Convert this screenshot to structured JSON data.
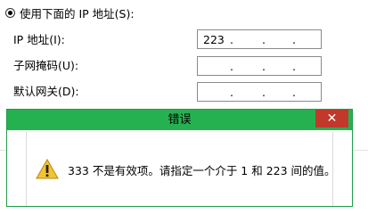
{
  "radio_use_ip": {
    "label": "使用下面的 IP 地址(S):"
  },
  "fields": {
    "ip": {
      "label": "IP 地址(I):",
      "value": "223"
    },
    "mask": {
      "label": "子网掩码(U):",
      "value": ""
    },
    "gateway": {
      "label": "默认网关(D):",
      "value": ""
    }
  },
  "ip_dot": ".",
  "dialog": {
    "title": "错误",
    "close_glyph": "✕",
    "message": "333 不是有效项。请指定一个介于 1 和 223 间的值。",
    "icon": "warning-icon"
  },
  "colors": {
    "titlebar": "#26b150",
    "close": "#c0392b",
    "warning": "#f4c430"
  }
}
